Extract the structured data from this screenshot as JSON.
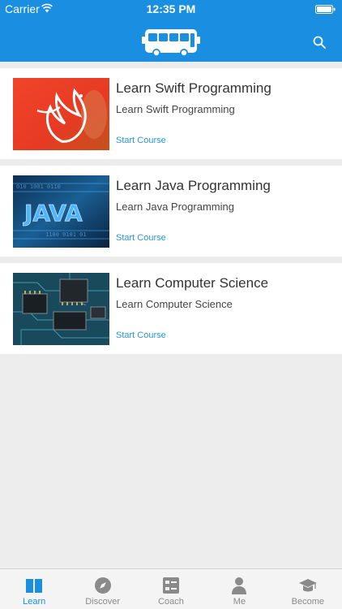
{
  "status_bar": {
    "carrier": "Carrier",
    "time": "12:35 PM"
  },
  "nav": {
    "logo_icon": "bus-icon",
    "search_icon": "search-icon"
  },
  "colors": {
    "brand": "#1a8ee0",
    "link": "#2a95d5",
    "background": "#ededed"
  },
  "courses": [
    {
      "title": "Learn Swift Programming",
      "subtitle": "Learn Swift Programming",
      "action": "Start Course",
      "thumbnail": "swift-logo-image"
    },
    {
      "title": "Learn Java Programming",
      "subtitle": "Learn Java Programming",
      "action": "Start Course",
      "thumbnail": "java-logo-image"
    },
    {
      "title": "Learn Computer Science",
      "subtitle": "Learn Computer Science",
      "action": "Start Course",
      "thumbnail": "circuit-board-image"
    }
  ],
  "tabs": [
    {
      "label": "Learn",
      "icon": "book-icon",
      "active": true
    },
    {
      "label": "Discover",
      "icon": "compass-icon",
      "active": false
    },
    {
      "label": "Coach",
      "icon": "checklist-icon",
      "active": false
    },
    {
      "label": "Me",
      "icon": "person-icon",
      "active": false
    },
    {
      "label": "Become",
      "icon": "graduation-cap-icon",
      "active": false
    }
  ]
}
